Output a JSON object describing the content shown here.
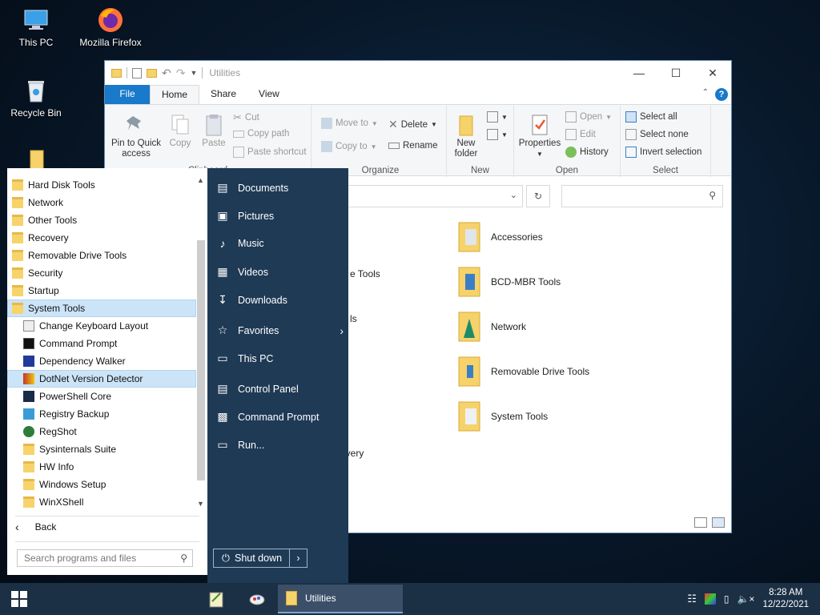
{
  "desktop": {
    "icons": [
      {
        "label": "This PC"
      },
      {
        "label": "Mozilla Firefox"
      },
      {
        "label": "Recycle Bin"
      }
    ]
  },
  "explorer": {
    "title": "Utilities",
    "tabs": [
      "File",
      "Home",
      "Share",
      "View"
    ],
    "ribbon": {
      "clipboard": {
        "pin_label_1": "Pin to Quick",
        "pin_label_2": "access",
        "copy": "Copy",
        "paste": "Paste",
        "cut": "Cut",
        "copy_path": "Copy path",
        "paste_shortcut": "Paste shortcut",
        "group": "Clipboard"
      },
      "organize": {
        "move_to": "Move to",
        "copy_to": "Copy to",
        "delete": "Delete",
        "rename": "Rename",
        "group": "Organize"
      },
      "new": {
        "new_folder_1": "New",
        "new_folder_2": "folder",
        "group": "New"
      },
      "open": {
        "properties": "Properties",
        "open": "Open",
        "edit": "Edit",
        "history": "History",
        "group": "Open"
      },
      "select": {
        "select_all": "Select all",
        "select_none": "Select none",
        "invert": "Invert selection",
        "group": "Select"
      }
    },
    "search_placeholder": "",
    "folders": [
      {
        "name": "Accessories"
      },
      {
        "name": "BCD-MBR Tools"
      },
      {
        "name": "Network"
      },
      {
        "name": "Removable Drive Tools"
      },
      {
        "name": "System Tools"
      }
    ],
    "partial_labels": [
      "e Tools",
      "ls",
      "overy"
    ]
  },
  "start_menu": {
    "programs": [
      {
        "label": "Hard Disk Tools",
        "type": "folder"
      },
      {
        "label": "Network",
        "type": "folder"
      },
      {
        "label": "Other Tools",
        "type": "folder"
      },
      {
        "label": "Recovery",
        "type": "folder"
      },
      {
        "label": "Removable Drive Tools",
        "type": "folder"
      },
      {
        "label": "Security",
        "type": "folder"
      },
      {
        "label": "Startup",
        "type": "folder"
      },
      {
        "label": "System Tools",
        "type": "folder",
        "selected": true
      },
      {
        "label": "Change Keyboard Layout",
        "type": "app"
      },
      {
        "label": "Command Prompt",
        "type": "app"
      },
      {
        "label": "Dependency Walker",
        "type": "app"
      },
      {
        "label": "DotNet Version Detector",
        "type": "app",
        "hover": true
      },
      {
        "label": "PowerShell Core",
        "type": "app"
      },
      {
        "label": "Registry Backup",
        "type": "app"
      },
      {
        "label": "RegShot",
        "type": "app"
      },
      {
        "label": "Sysinternals Suite",
        "type": "folder"
      },
      {
        "label": "HW Info",
        "type": "folder"
      },
      {
        "label": "Windows Setup",
        "type": "folder"
      },
      {
        "label": "WinXShell",
        "type": "folder"
      }
    ],
    "back_label": "Back",
    "search_placeholder": "Search programs and files",
    "right_items": [
      {
        "label": "Documents",
        "icon": "document-icon"
      },
      {
        "label": "Pictures",
        "icon": "pictures-icon"
      },
      {
        "label": "Music",
        "icon": "music-icon"
      },
      {
        "label": "Videos",
        "icon": "videos-icon"
      },
      {
        "label": "Downloads",
        "icon": "downloads-icon"
      },
      {
        "label": "Favorites",
        "icon": "star-icon"
      },
      {
        "label": "This PC",
        "icon": "computer-icon"
      },
      {
        "label": "Control Panel",
        "icon": "control-panel-icon"
      },
      {
        "label": "Command Prompt",
        "icon": "cmd-icon"
      },
      {
        "label": "Run...",
        "icon": "run-icon"
      }
    ],
    "shutdown_label": "Shut down"
  },
  "taskbar": {
    "active_window": "Utilities",
    "time": "8:28 AM",
    "date": "12/22/2021"
  },
  "colors": {
    "accent": "#1979ca",
    "start_panel": "#1f3a55",
    "taskbar": "#1b2f45"
  }
}
